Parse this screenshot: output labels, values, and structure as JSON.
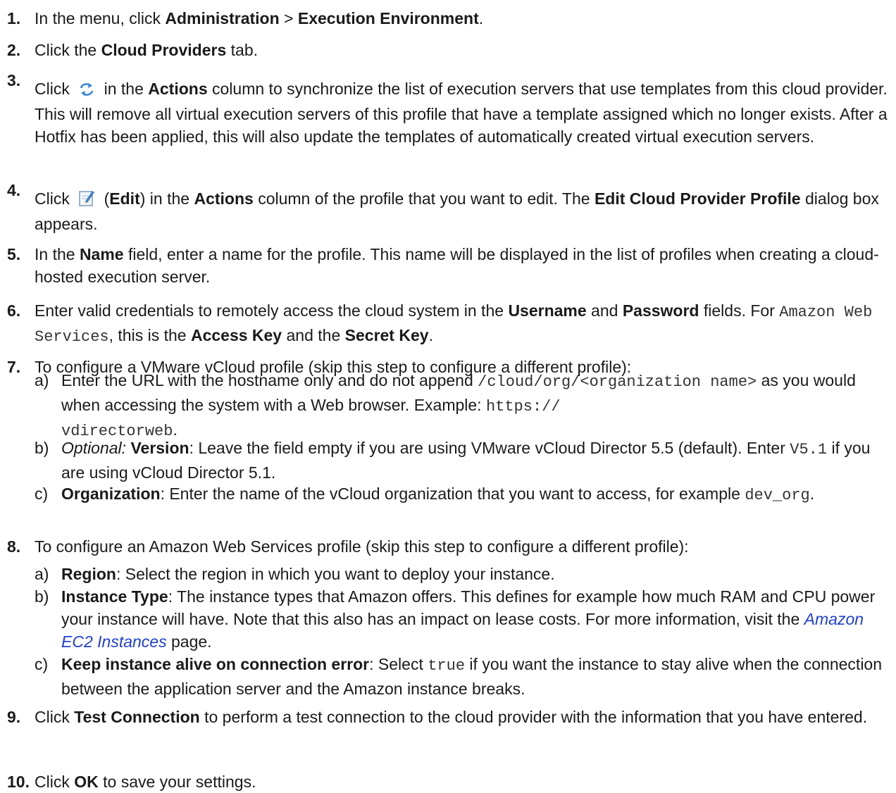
{
  "steps": [
    {
      "num": "1.",
      "parts": [
        "In the menu, click ",
        "Administration",
        " > ",
        "Execution Environment",
        "."
      ]
    },
    {
      "num": "2.",
      "parts": [
        "Click the ",
        "Cloud Providers",
        " tab."
      ]
    },
    {
      "num": "3.",
      "parts": [
        "Click ",
        " in the ",
        "Actions",
        " column to synchronize the list of execution servers that use templates from this cloud provider. This will remove all virtual execution servers of this profile that have a template assigned which no longer exists. After a Hotfix has been applied, this will also update the templates of automatically created virtual execution servers."
      ]
    },
    {
      "num": "4.",
      "parts": [
        "Click ",
        " (",
        "Edit",
        ") in the ",
        "Actions",
        " column of the profile that you want to edit. The ",
        "Edit Cloud Provider Profile",
        " dialog box appears."
      ]
    },
    {
      "num": "5.",
      "parts": [
        "In the ",
        "Name",
        " field, enter a name for the profile. This name will be displayed in the list of profiles when creating a cloud-hosted execution server."
      ]
    },
    {
      "num": "6.",
      "parts": [
        "Enter valid credentials to remotely access the cloud system in the ",
        "Username",
        " and ",
        "Password",
        " fields. For ",
        "Amazon Web Services",
        ", this is the ",
        "Access Key",
        " and the ",
        "Secret Key",
        "."
      ]
    },
    {
      "num": "7.",
      "parts": [
        "To configure a VMware vCloud profile (skip this step to configure a different profile):"
      ],
      "subs": [
        {
          "letter": "a)",
          "parts": [
            "Enter the URL with the hostname only and do not append ",
            "/cloud/org/<organization name>",
            " as you would when accessing the system with a Web browser. Example: ",
            "https://",
            "vdirectorweb",
            "."
          ]
        },
        {
          "letter": "b)",
          "parts": [
            "Optional:",
            "Version",
            ": Leave the field empty if you are using VMware vCloud Director 5.5 (default). Enter ",
            "V5.1",
            " if you are using vCloud Director 5.1."
          ]
        },
        {
          "letter": "c)",
          "parts": [
            "Organization",
            ": Enter the name of the vCloud organization that you want to access, for example ",
            "dev_org",
            "."
          ]
        }
      ]
    },
    {
      "num": "8.",
      "parts": [
        "To configure an Amazon Web Services profile (skip this step to configure a different profile):"
      ],
      "subs": [
        {
          "letter": "a)",
          "parts": [
            "Region",
            ": Select the region in which you want to deploy your instance."
          ]
        },
        {
          "letter": "b)",
          "parts": [
            "Instance Type",
            ": The instance types that Amazon offers. This defines for example how much RAM and CPU power your instance will have. Note that this also has an impact on lease costs. For more information, visit the ",
            "Amazon EC2 Instances",
            " page."
          ]
        },
        {
          "letter": "c)",
          "parts": [
            "Keep instance alive on connection error",
            ": Select ",
            "true",
            " if you want the instance to stay alive when the connection between the application server and the Amazon instance breaks."
          ]
        }
      ]
    },
    {
      "num": "9.",
      "parts": [
        "Click ",
        "Test Connection",
        " to perform a test connection to the cloud provider with the information that you have entered."
      ]
    },
    {
      "num": "10.",
      "parts": [
        "Click ",
        "OK",
        " to save your settings."
      ]
    }
  ],
  "icons": {
    "sync": "sync-icon",
    "edit": "edit-icon"
  },
  "colors": {
    "link": "#1f3fd6",
    "sync_icon": "#3a86d6"
  }
}
